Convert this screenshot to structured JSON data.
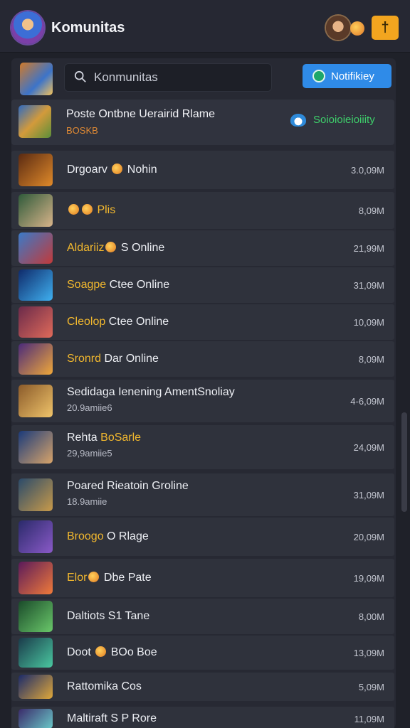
{
  "header": {
    "title": "Komunitas",
    "pin_label": "†"
  },
  "toolbar": {
    "search_value": "Konmunitas",
    "notify_label": "Notifikiey"
  },
  "featured": {
    "title": "Poste Ontbne Uerairid Rlame",
    "subtitle": "BOSKB",
    "badge": "Soioioieioiiity"
  },
  "rows": [
    {
      "title_hl": "",
      "title": "Drgoarv",
      "coin": true,
      "title2": "Nohin",
      "sub": "",
      "count": "3.0,09M",
      "thumb": [
        "#5a2a12",
        "#e08a2a"
      ]
    },
    {
      "title_hl": "",
      "title": "",
      "coin": true,
      "coin2": true,
      "title2": "Plis",
      "title2_hl": true,
      "sub": "",
      "count": "8,09M",
      "thumb": [
        "#2f5a3a",
        "#d8b48a"
      ]
    },
    {
      "title_hl": "Aldariiz",
      "title": "",
      "coin": true,
      "title2": "S Online",
      "sub": "",
      "count": "21,99M",
      "thumb": [
        "#3a7ac8",
        "#c23a3a"
      ]
    },
    {
      "title_hl": "Soagpe",
      "title": "",
      "coin": false,
      "title2": "Ctee Online",
      "sub": "",
      "count": "31,09M",
      "thumb": [
        "#0f2a6a",
        "#3fb0f0"
      ]
    },
    {
      "title_hl": "Cleolop",
      "title": "",
      "coin": false,
      "title2": "Ctee Online",
      "sub": "",
      "count": "10,09M",
      "thumb": [
        "#6a2a4a",
        "#e06a5a"
      ]
    },
    {
      "title_hl": "Sronrd",
      "title": "",
      "coin": false,
      "title2": "Dar Online",
      "sub": "",
      "count": "8,09M",
      "thumb": [
        "#4a2a7a",
        "#f0a83a"
      ]
    },
    {
      "title_hl": "",
      "title": "Sedidaga Ienening AmentSnoliay",
      "coin": false,
      "title2": "",
      "sub": "20.9amiie6",
      "count": "4-6,09M",
      "thumb": [
        "#8a5a2a",
        "#f0c46a"
      ]
    },
    {
      "title_hl": "",
      "title": "Rehta",
      "coin": false,
      "title2": "BoSarle",
      "title2_hl": true,
      "sub": "29,9amiie5",
      "count": "24,09M",
      "thumb": [
        "#1a3a7a",
        "#d8a46a"
      ]
    },
    {
      "title_hl": "",
      "title": "Poared Rieatoin Groline",
      "coin": false,
      "title2": "",
      "sub": "18.9amiie",
      "count": "31,09M",
      "thumb": [
        "#2a4a6a",
        "#c89a4a"
      ]
    },
    {
      "title_hl": "Broogo",
      "title": "",
      "coin": false,
      "title2": "O Rlage",
      "sub": "",
      "count": "20,09M",
      "thumb": [
        "#2a2a6a",
        "#8a5ac8"
      ]
    },
    {
      "title_hl": "Elor",
      "title": "",
      "coin": true,
      "title2": "Dbe Pate",
      "sub": "",
      "count": "19,09M",
      "thumb": [
        "#5a1a5a",
        "#f07a3a"
      ]
    },
    {
      "title_hl": "",
      "title": "Daltiots S1 Tane",
      "coin": false,
      "title2": "",
      "sub": "",
      "count": "8,00M",
      "thumb": [
        "#1a4a2a",
        "#6ac86a"
      ]
    },
    {
      "title_hl": "",
      "title": "Doot",
      "coin": true,
      "title2": "BOo Boe",
      "sub": "",
      "count": "13,09M",
      "thumb": [
        "#1a3a4a",
        "#4ac8a0"
      ]
    },
    {
      "title_hl": "",
      "title": "Rattomika Cos",
      "coin": false,
      "title2": "",
      "sub": "",
      "count": "5,09M",
      "thumb": [
        "#1a2a6a",
        "#e0a83a"
      ]
    },
    {
      "title_hl": "",
      "title": "Maltiraft S P Rore",
      "coin": false,
      "title2": "",
      "sub": "",
      "count": "11,09M",
      "thumb": [
        "#3a2a6a",
        "#6ac8c8"
      ]
    }
  ]
}
